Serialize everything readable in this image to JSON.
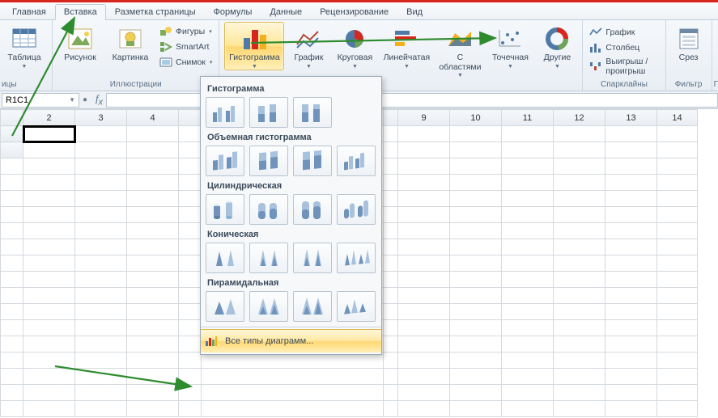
{
  "tabs": {
    "home": "Главная",
    "insert": "Вставка",
    "layout": "Разметка страницы",
    "formulas": "Формулы",
    "data": "Данные",
    "review": "Рецензирование",
    "view": "Вид"
  },
  "ribbon": {
    "tables_group": "ицы",
    "table": "Таблица",
    "illustrations_group": "Иллюстрации",
    "picture": "Рисунок",
    "clipart": "Картинка",
    "shapes": "Фигуры",
    "smartart": "SmartArt",
    "screenshot": "Снимок",
    "histogram": "Гистограмма",
    "line_chart": "График",
    "pie_chart": "Круговая",
    "bar_chart": "Линейчатая",
    "area_chart": "С областями",
    "scatter_chart": "Точечная",
    "other_charts": "Другие",
    "spark_line": "График",
    "spark_column": "Столбец",
    "spark_winloss": "Выигрыш / проигрыш",
    "sparklines_group": "Спарклайны",
    "slicer": "Срез",
    "filter_group": "Фильтр"
  },
  "cellref": "R1C1",
  "columns": [
    "",
    "2",
    "3",
    "4",
    "",
    "",
    "",
    "9",
    "10",
    "11",
    "12",
    "13",
    "14"
  ],
  "dropdown": {
    "hist": "Гистограмма",
    "hist3d": "Объемная гистограмма",
    "cyl": "Цилиндрическая",
    "cone": "Коническая",
    "pyr": "Пирамидальная",
    "all": "Все типы диаграмм..."
  }
}
